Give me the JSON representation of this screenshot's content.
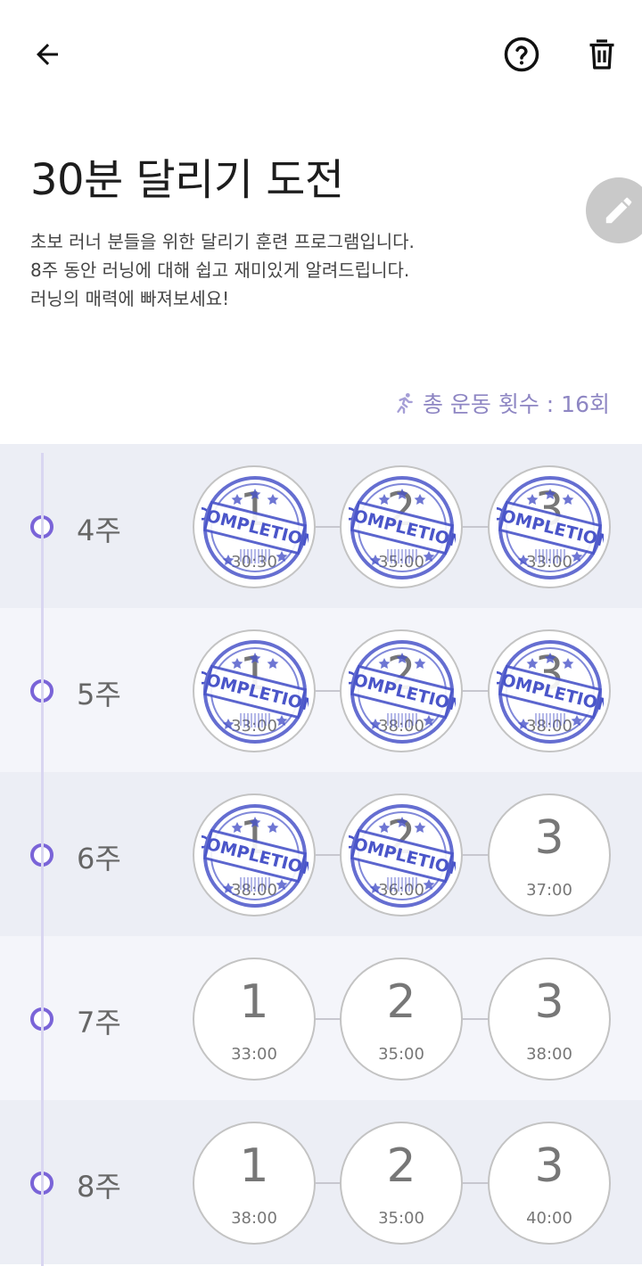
{
  "header": {
    "back_icon": "arrow-left-icon",
    "help_icon": "question-circle-icon",
    "delete_icon": "trash-icon"
  },
  "program": {
    "title": "30분 달리기 도전",
    "description": [
      "초보 러너 분들을 위한 달리기 훈련 프로그램입니다.",
      "8주 동안 러닝에 대해 쉽고 재미있게 알려드립니다.",
      "러닝의 매력에 빠져보세요!"
    ],
    "edit_icon": "pencil-icon",
    "total_workouts": "총 운동 횟수 : 16회",
    "total_icon": "running-icon"
  },
  "stamp_text": "COMPLETION",
  "colors": {
    "accent": "#7a64d8",
    "stamp": "#4a55c9",
    "total_text": "#8e86c3"
  },
  "weeks": [
    {
      "label": "4주",
      "sessions": [
        {
          "num": "1",
          "time": "30:30",
          "done": true
        },
        {
          "num": "2",
          "time": "35:00",
          "done": true
        },
        {
          "num": "3",
          "time": "33:00",
          "done": true
        }
      ]
    },
    {
      "label": "5주",
      "sessions": [
        {
          "num": "1",
          "time": "33:00",
          "done": true
        },
        {
          "num": "2",
          "time": "38:00",
          "done": true
        },
        {
          "num": "3",
          "time": "38:00",
          "done": true
        }
      ]
    },
    {
      "label": "6주",
      "sessions": [
        {
          "num": "1",
          "time": "38:00",
          "done": true
        },
        {
          "num": "2",
          "time": "36:00",
          "done": true
        },
        {
          "num": "3",
          "time": "37:00",
          "done": false
        }
      ]
    },
    {
      "label": "7주",
      "sessions": [
        {
          "num": "1",
          "time": "33:00",
          "done": false
        },
        {
          "num": "2",
          "time": "35:00",
          "done": false
        },
        {
          "num": "3",
          "time": "38:00",
          "done": false
        }
      ]
    },
    {
      "label": "8주",
      "sessions": [
        {
          "num": "1",
          "time": "38:00",
          "done": false
        },
        {
          "num": "2",
          "time": "35:00",
          "done": false
        },
        {
          "num": "3",
          "time": "40:00",
          "done": false
        }
      ]
    }
  ]
}
